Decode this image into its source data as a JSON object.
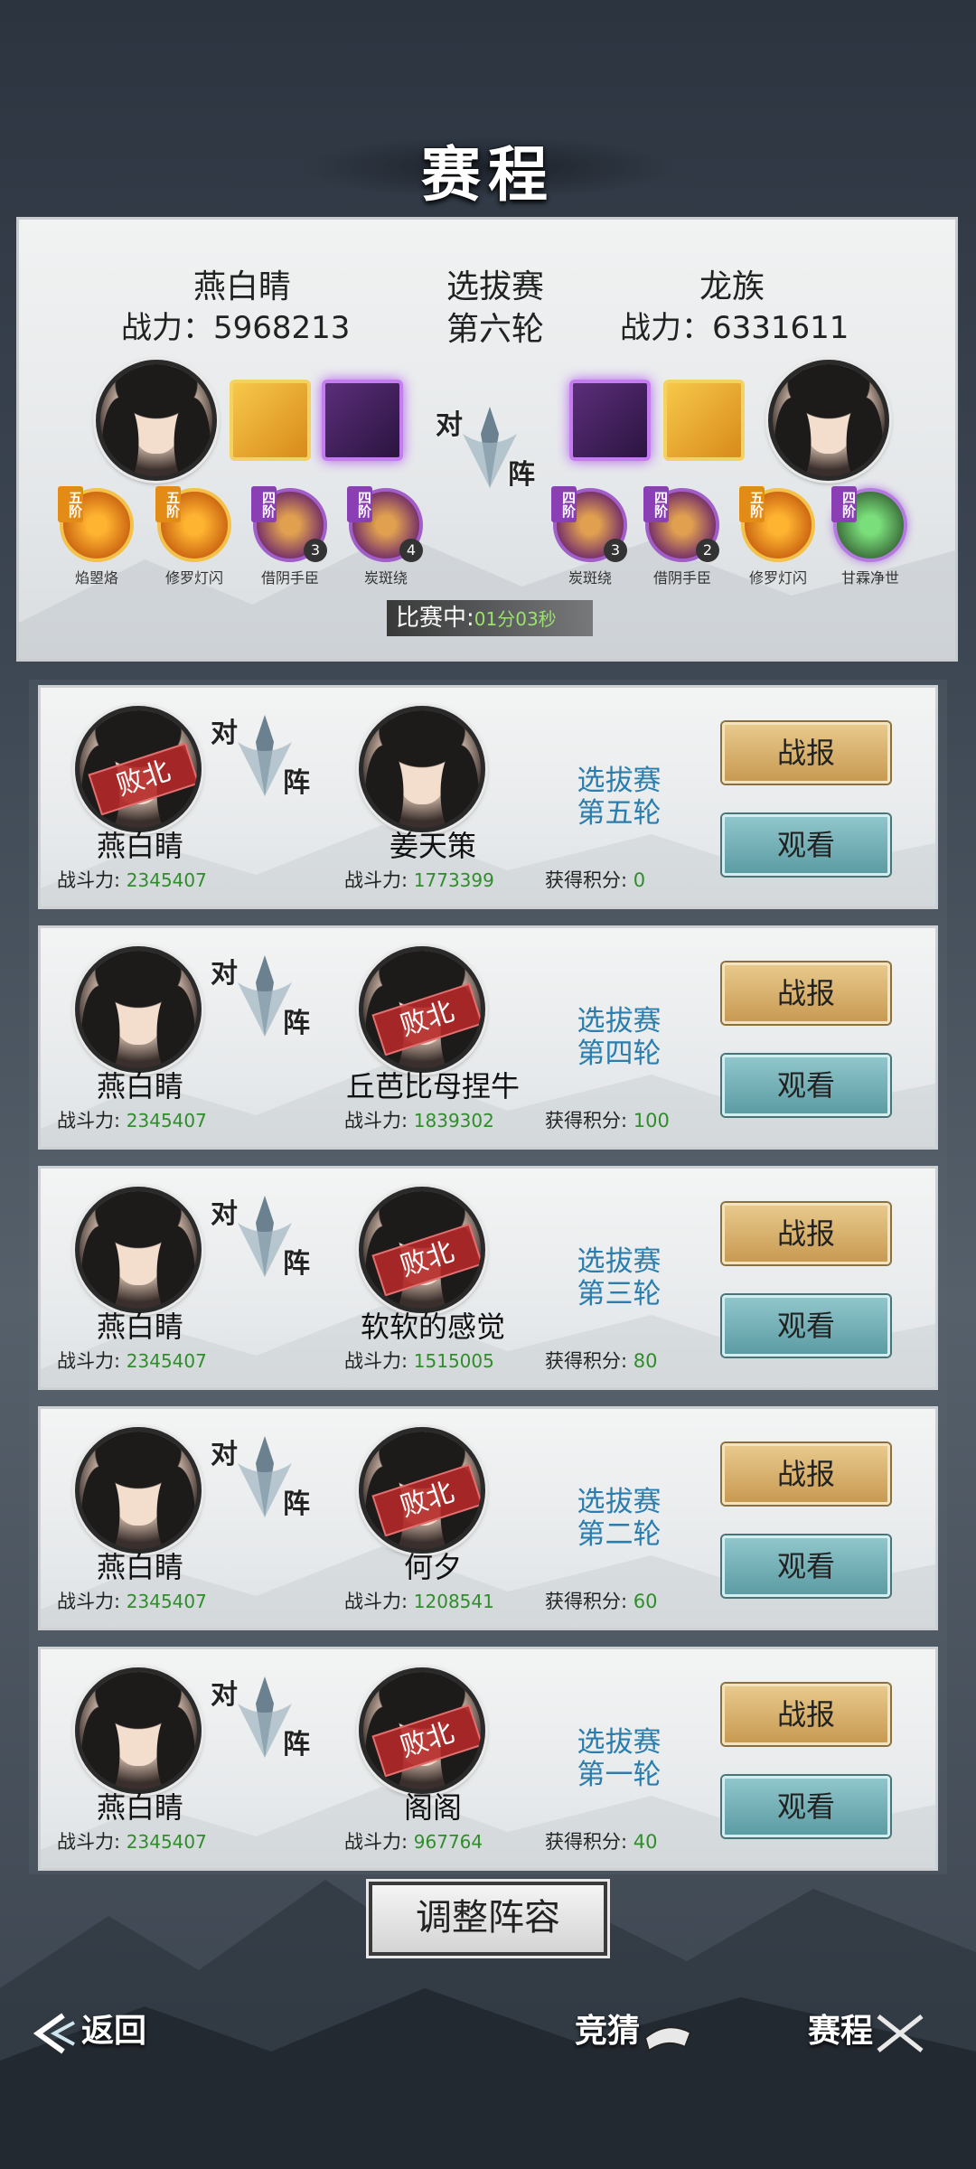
{
  "header": {
    "title": "赛程"
  },
  "current_match": {
    "left": {
      "name": "燕白睛",
      "power_label": "战力：",
      "power": "5968213"
    },
    "right": {
      "name": "龙族",
      "power_label": "战力：",
      "power": "6331611"
    },
    "round": {
      "line1": "选拔赛",
      "line2": "第六轮"
    },
    "vs": {
      "char1": "对",
      "char2": "阵"
    },
    "left_skills": [
      {
        "tier": "五阶",
        "label": "焰曌烙",
        "count": ""
      },
      {
        "tier": "五阶",
        "label": "修罗灯闪",
        "count": ""
      },
      {
        "tier": "四阶",
        "label": "借阴手臣",
        "count": "3"
      },
      {
        "tier": "四阶",
        "label": "炭斑绕",
        "count": "4"
      }
    ],
    "right_skills": [
      {
        "tier": "四阶",
        "label": "炭斑绕",
        "count": "3"
      },
      {
        "tier": "四阶",
        "label": "借阴手臣",
        "count": "2"
      },
      {
        "tier": "五阶",
        "label": "修罗灯闪",
        "count": ""
      },
      {
        "tier": "四阶",
        "label": "甘霖净世",
        "count": ""
      }
    ],
    "status": {
      "label": "比赛中:",
      "time": "01分03秒"
    }
  },
  "history_labels": {
    "power_label": "战斗力:",
    "points_label": "获得积分:",
    "defeat": "败北",
    "report_btn": "战报",
    "watch_btn": "观看"
  },
  "history": [
    {
      "left_name": "燕白睛",
      "left_power": "2345407",
      "right_name": "姜天策",
      "right_power": "1773399",
      "round1": "选拔赛",
      "round2": "第五轮",
      "points": "0",
      "loser": "left"
    },
    {
      "left_name": "燕白睛",
      "left_power": "2345407",
      "right_name": "丘芭比母捏牛",
      "right_power": "1839302",
      "round1": "选拔赛",
      "round2": "第四轮",
      "points": "100",
      "loser": "right"
    },
    {
      "left_name": "燕白睛",
      "left_power": "2345407",
      "right_name": "软软的感觉",
      "right_power": "1515005",
      "round1": "选拔赛",
      "round2": "第三轮",
      "points": "80",
      "loser": "right"
    },
    {
      "left_name": "燕白睛",
      "left_power": "2345407",
      "right_name": "何夕",
      "right_power": "1208541",
      "round1": "选拔赛",
      "round2": "第二轮",
      "points": "60",
      "loser": "right"
    },
    {
      "left_name": "燕白睛",
      "left_power": "2345407",
      "right_name": "阁阁",
      "right_power": "967764",
      "round1": "选拔赛",
      "round2": "第一轮",
      "points": "40",
      "loser": "right"
    }
  ],
  "adjust_button": "调整阵容",
  "bottom_nav": {
    "back": "返回",
    "guess": "竞猜",
    "schedule": "赛程"
  }
}
